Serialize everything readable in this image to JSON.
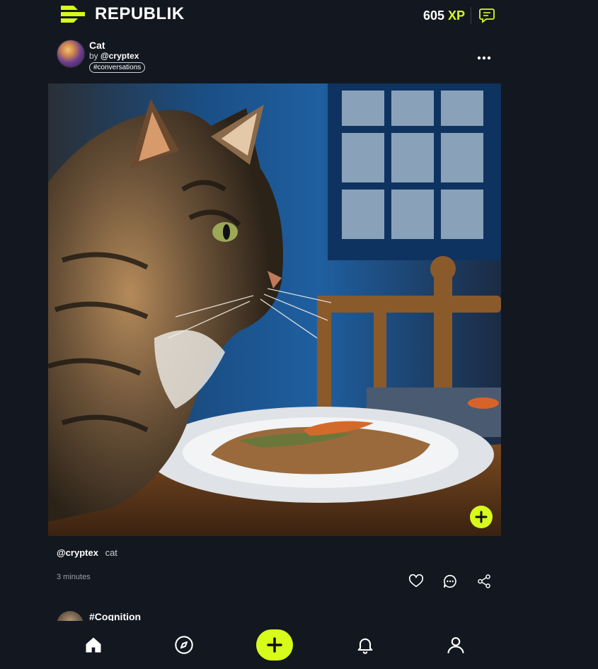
{
  "header": {
    "brand": "REPUBLIK",
    "xp_value": "605",
    "xp_unit": "XP",
    "accent_color": "#d7fb1b"
  },
  "post": {
    "title": "Cat",
    "by_prefix": "by",
    "author": "@cryptex",
    "tag": "#conversations",
    "caption_user": "@cryptex",
    "caption_text": "cat",
    "timestamp": "3 minutes",
    "image_icon": "cat-photo",
    "actions": [
      "heart-icon",
      "comment-icon",
      "share-icon"
    ]
  },
  "next_post": {
    "title": "#Cognition"
  },
  "nav": {
    "items": [
      "home-icon",
      "explore-icon",
      "create-icon",
      "bell-icon",
      "profile-icon"
    ]
  }
}
